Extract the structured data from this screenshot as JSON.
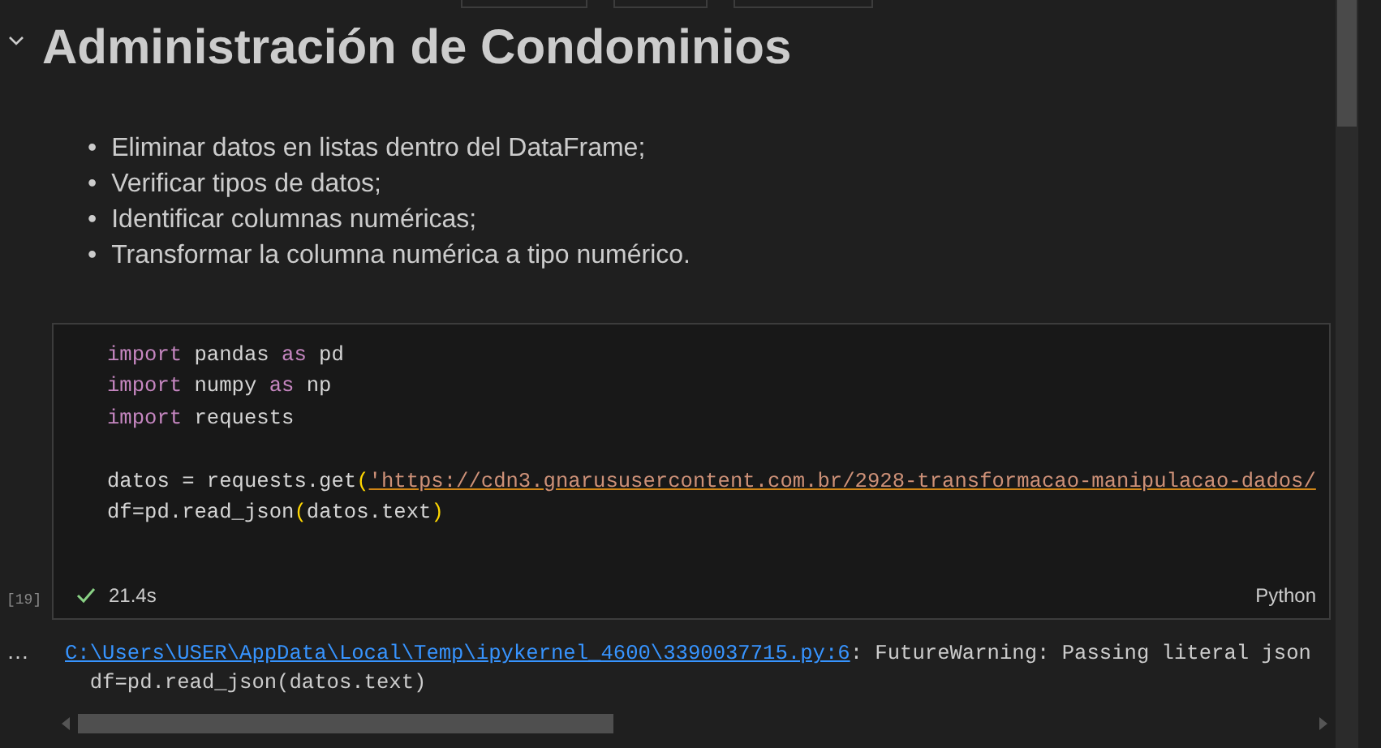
{
  "heading": {
    "text": "Administración de Condominios",
    "expanded": true
  },
  "bullets": [
    {
      "marker": "•",
      "text": "Eliminar datos en listas dentro del DataFrame;"
    },
    {
      "marker": "•",
      "text": "Verificar tipos de datos;"
    },
    {
      "marker": "•",
      "text": "Identificar columnas numéricas;"
    },
    {
      "marker": "•",
      "text": "Transformar la columna numérica a tipo numérico."
    }
  ],
  "code_cell": {
    "lines": [
      {
        "kind": "code",
        "tokens": [
          {
            "kind": "keyword",
            "text": "import"
          },
          {
            "kind": "plain",
            "text": " pandas "
          },
          {
            "kind": "keyword",
            "text": "as"
          },
          {
            "kind": "plain",
            "text": " pd"
          }
        ]
      },
      {
        "kind": "code",
        "tokens": [
          {
            "kind": "keyword",
            "text": "import"
          },
          {
            "kind": "plain",
            "text": " numpy "
          },
          {
            "kind": "keyword",
            "text": "as"
          },
          {
            "kind": "plain",
            "text": " np"
          }
        ]
      },
      {
        "kind": "code",
        "tokens": [
          {
            "kind": "keyword",
            "text": "import"
          },
          {
            "kind": "plain",
            "text": " requests"
          }
        ]
      },
      {
        "kind": "blank"
      },
      {
        "kind": "code",
        "tokens": [
          {
            "kind": "plain",
            "text": "datos = requests.get"
          },
          {
            "kind": "paren",
            "text": "("
          },
          {
            "kind": "string",
            "text": "'https://cdn3.gnarususercontent.com.br/2928-transformacao-manipulacao-dados/"
          }
        ]
      },
      {
        "kind": "code",
        "tokens": [
          {
            "kind": "plain",
            "text": "df=pd.read_json"
          },
          {
            "kind": "paren",
            "text": "("
          },
          {
            "kind": "plain",
            "text": "datos.text"
          },
          {
            "kind": "paren",
            "text": ")"
          }
        ]
      }
    ],
    "execution_count": "[19]",
    "success": true,
    "duration": "21.4s",
    "language": "Python"
  },
  "output": {
    "more": "…",
    "link": "C:\\Users\\USER\\AppData\\Local\\Temp\\ipykernel_4600\\3390037715.py:6",
    "message": ": FutureWarning: Passing literal json",
    "code": "df=pd.read_json(datos.text)"
  }
}
